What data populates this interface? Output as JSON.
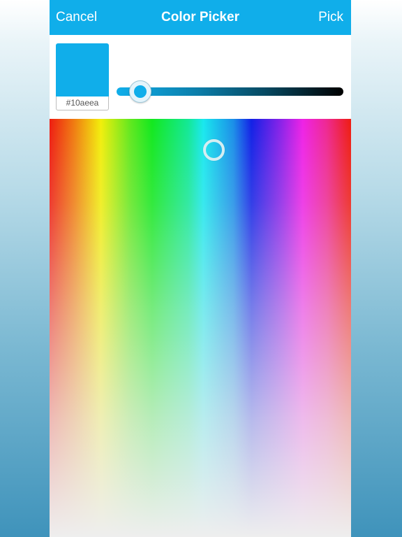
{
  "navbar": {
    "cancel_label": "Cancel",
    "title": "Color Picker",
    "pick_label": "Pick",
    "background": "#10aeea"
  },
  "color": {
    "selected_hex": "#10aeea",
    "hex_label": "#10aeea"
  },
  "brightness_slider": {
    "value": 0.1,
    "from_color": "#10aeea",
    "to_color": "#000000"
  },
  "spectrum": {
    "type": "hue-saturation",
    "selected_hue_color": "#18e8ee"
  }
}
